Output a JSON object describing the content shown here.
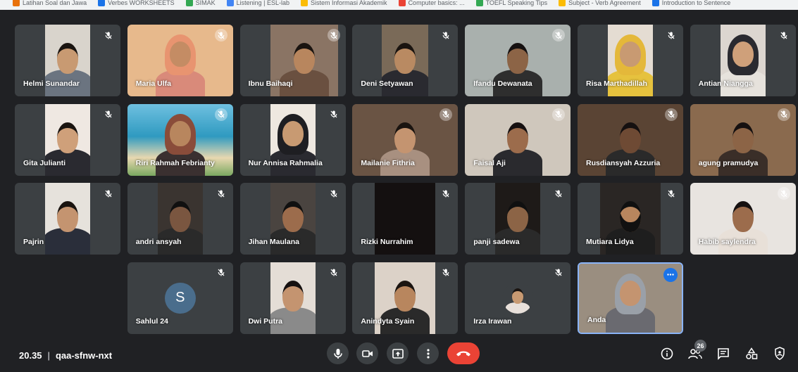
{
  "bookmarks": [
    {
      "label": "Latihan Soal dan Jawa",
      "color": "#e8710a"
    },
    {
      "label": "Verbes WORKSHEETS",
      "color": "#1a73e8"
    },
    {
      "label": "SIMAK",
      "color": "#34a853"
    },
    {
      "label": "Listening | ESL-lab",
      "color": "#4285f4"
    },
    {
      "label": "Sistem Informasi Akademik",
      "color": "#fbbc04"
    },
    {
      "label": "Computer basics: ...",
      "color": "#ea4335"
    },
    {
      "label": "TOEFL Speaking Tips",
      "color": "#34a853"
    },
    {
      "label": "Subject - Verb Agreement",
      "color": "#fbbc04"
    },
    {
      "label": "Introduction to Sentence",
      "color": "#1a73e8"
    }
  ],
  "participants": [
    {
      "name": "Helmi Sunandar"
    },
    {
      "name": "Maria Ulfa"
    },
    {
      "name": "Ibnu Baihaqi"
    },
    {
      "name": "Deni Setyawan"
    },
    {
      "name": "Ifandu Dewanata"
    },
    {
      "name": "Risa Marthadillah"
    },
    {
      "name": "Antian Niangga"
    },
    {
      "name": "Gita Julianti"
    },
    {
      "name": "Riri Rahmah Febrianty"
    },
    {
      "name": "Nur Annisa Rahmalia"
    },
    {
      "name": "Mailanie Fithria"
    },
    {
      "name": "Faisal Aji"
    },
    {
      "name": "Rusdiansyah Azzuria"
    },
    {
      "name": "agung pramudya"
    },
    {
      "name": "Pajrin"
    },
    {
      "name": "andri ansyah"
    },
    {
      "name": "Jihan Maulana"
    },
    {
      "name": "Rizki Nurrahim"
    },
    {
      "name": "panji sadewa"
    },
    {
      "name": "Mutiara Lidya"
    },
    {
      "name": "Habib saylendra"
    },
    {
      "name": "Sahlul 24",
      "avatar_letter": "S"
    },
    {
      "name": "Dwi Putra"
    },
    {
      "name": "Anindyta Syain"
    },
    {
      "name": "Irza Irawan"
    },
    {
      "name": "Anda"
    }
  ],
  "meeting": {
    "time": "20.35",
    "separator": "|",
    "code": "qaa-sfnw-nxt"
  },
  "controls": [
    "mic-icon",
    "camera-icon",
    "present-icon",
    "more-options-icon",
    "end-call-icon"
  ],
  "right_controls": [
    "info-icon",
    "people-icon",
    "chat-icon",
    "activities-icon",
    "host-controls-icon"
  ],
  "participant_count": "26",
  "colors": {
    "background": "#202124",
    "tile": "#3c4043",
    "end_call": "#ea4335",
    "self_border": "#8ab4f8",
    "accent": "#1a73e8"
  }
}
